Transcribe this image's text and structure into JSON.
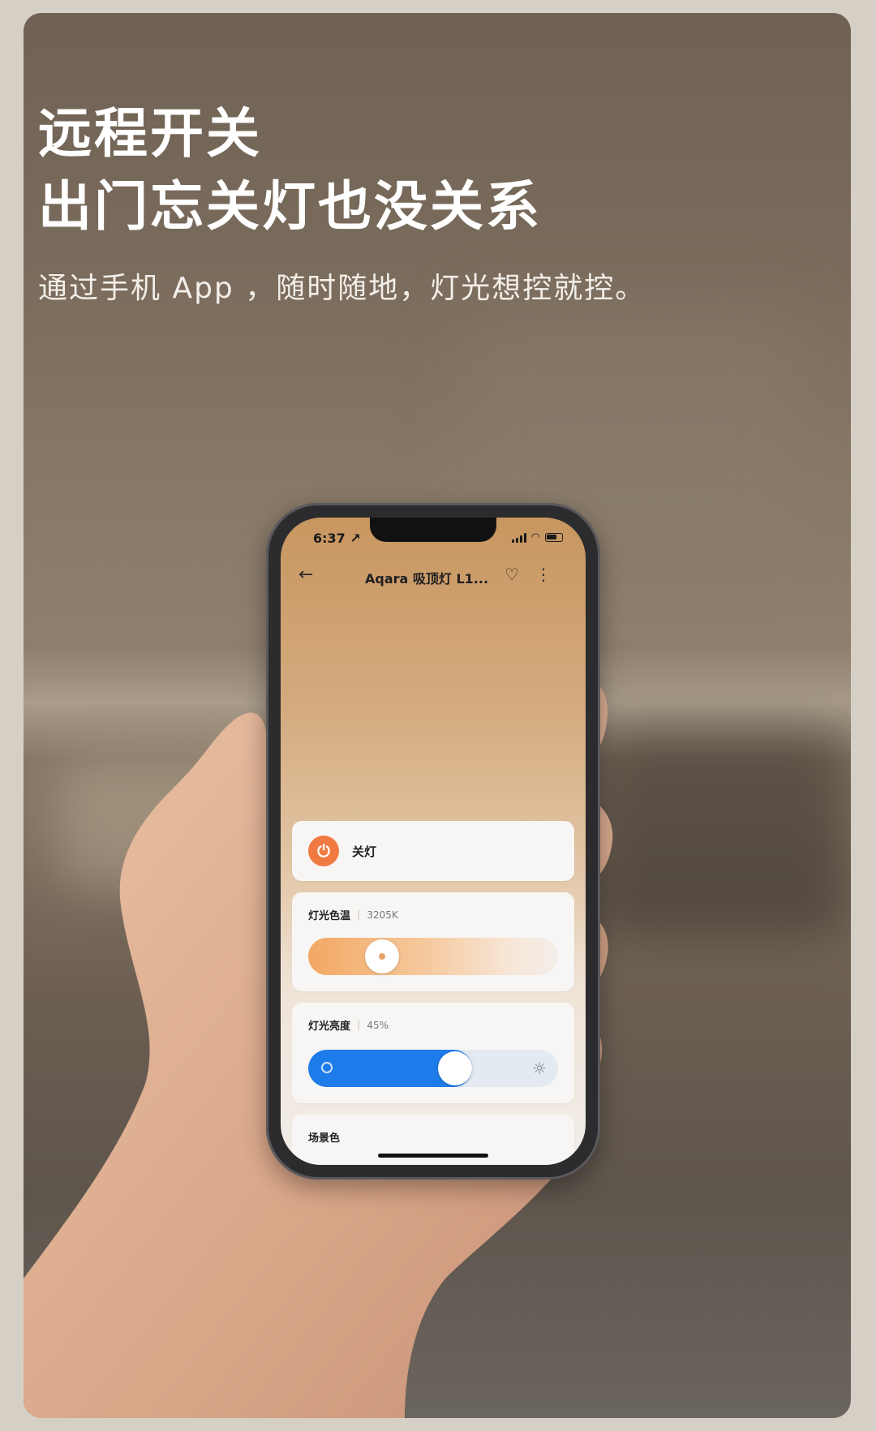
{
  "headline": {
    "line1": "远程开关",
    "line2": "出门忘关灯也没关系",
    "subtitle": "通过手机 App ，随时随地，灯光想控就控。"
  },
  "status_bar": {
    "time": "6:37 ↗"
  },
  "nav": {
    "title": "Aqara 吸顶灯 L1...",
    "back_icon": "arrow-left-icon",
    "favorite_icon": "heart-icon",
    "more_icon": "more-vertical-icon"
  },
  "power": {
    "label": "关灯",
    "icon": "power-icon",
    "color": "#f07a42"
  },
  "color_temp": {
    "label": "灯光色温",
    "value": "3205K",
    "slider_fraction": 0.26
  },
  "brightness": {
    "label": "灯光亮度",
    "value": "45%",
    "level": 0.45,
    "fill_color": "#1e7bea"
  },
  "scene": {
    "label": "场景色"
  }
}
